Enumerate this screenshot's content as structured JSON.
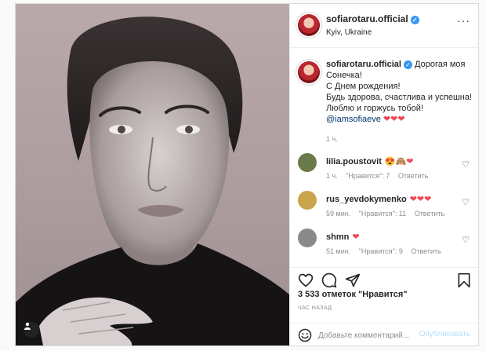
{
  "post": {
    "author": "sofiarotaru.official",
    "location": "Kyiv, Ukraine",
    "verified_icon": "verified-badge-icon"
  },
  "caption": {
    "username": "sofiarotaru.official",
    "lines": [
      "Дорогая моя",
      "Сонечка!",
      "С Днем рождения!",
      "Будь здорова, счастлива и успешна!",
      "Люблю и горжусь тобой!"
    ],
    "mention": "@iamsofiaeve",
    "emoji": "❤❤❤",
    "time": "1 ч."
  },
  "comments": [
    {
      "username": "lilia.poustovit",
      "text": "😍🙈❤",
      "time": "1 ч.",
      "likes": "\"Нравится\": 7",
      "reply": "Ответить",
      "avatar_color": "#6b7a4a"
    },
    {
      "username": "rus_yevdokymenko",
      "text": "❤❤❤",
      "time": "59 мин.",
      "likes": "\"Нравится\": 11",
      "reply": "Ответить",
      "avatar_color": "#c9a44a"
    },
    {
      "username": "shmn",
      "text": "❤",
      "time": "51 мин.",
      "likes": "\"Нравится\": 9",
      "reply": "Ответить",
      "avatar_color": "#8a8a8a"
    }
  ],
  "actions": {
    "likes_text": "3 533 отметок \"Нравится\"",
    "ago": "час назад",
    "comment_placeholder": "Добавьте комментарий...",
    "post_label": "Опубликовать"
  },
  "colors": {
    "link": "#00376b",
    "heart": "#ed4956",
    "verified": "#3897f0"
  }
}
